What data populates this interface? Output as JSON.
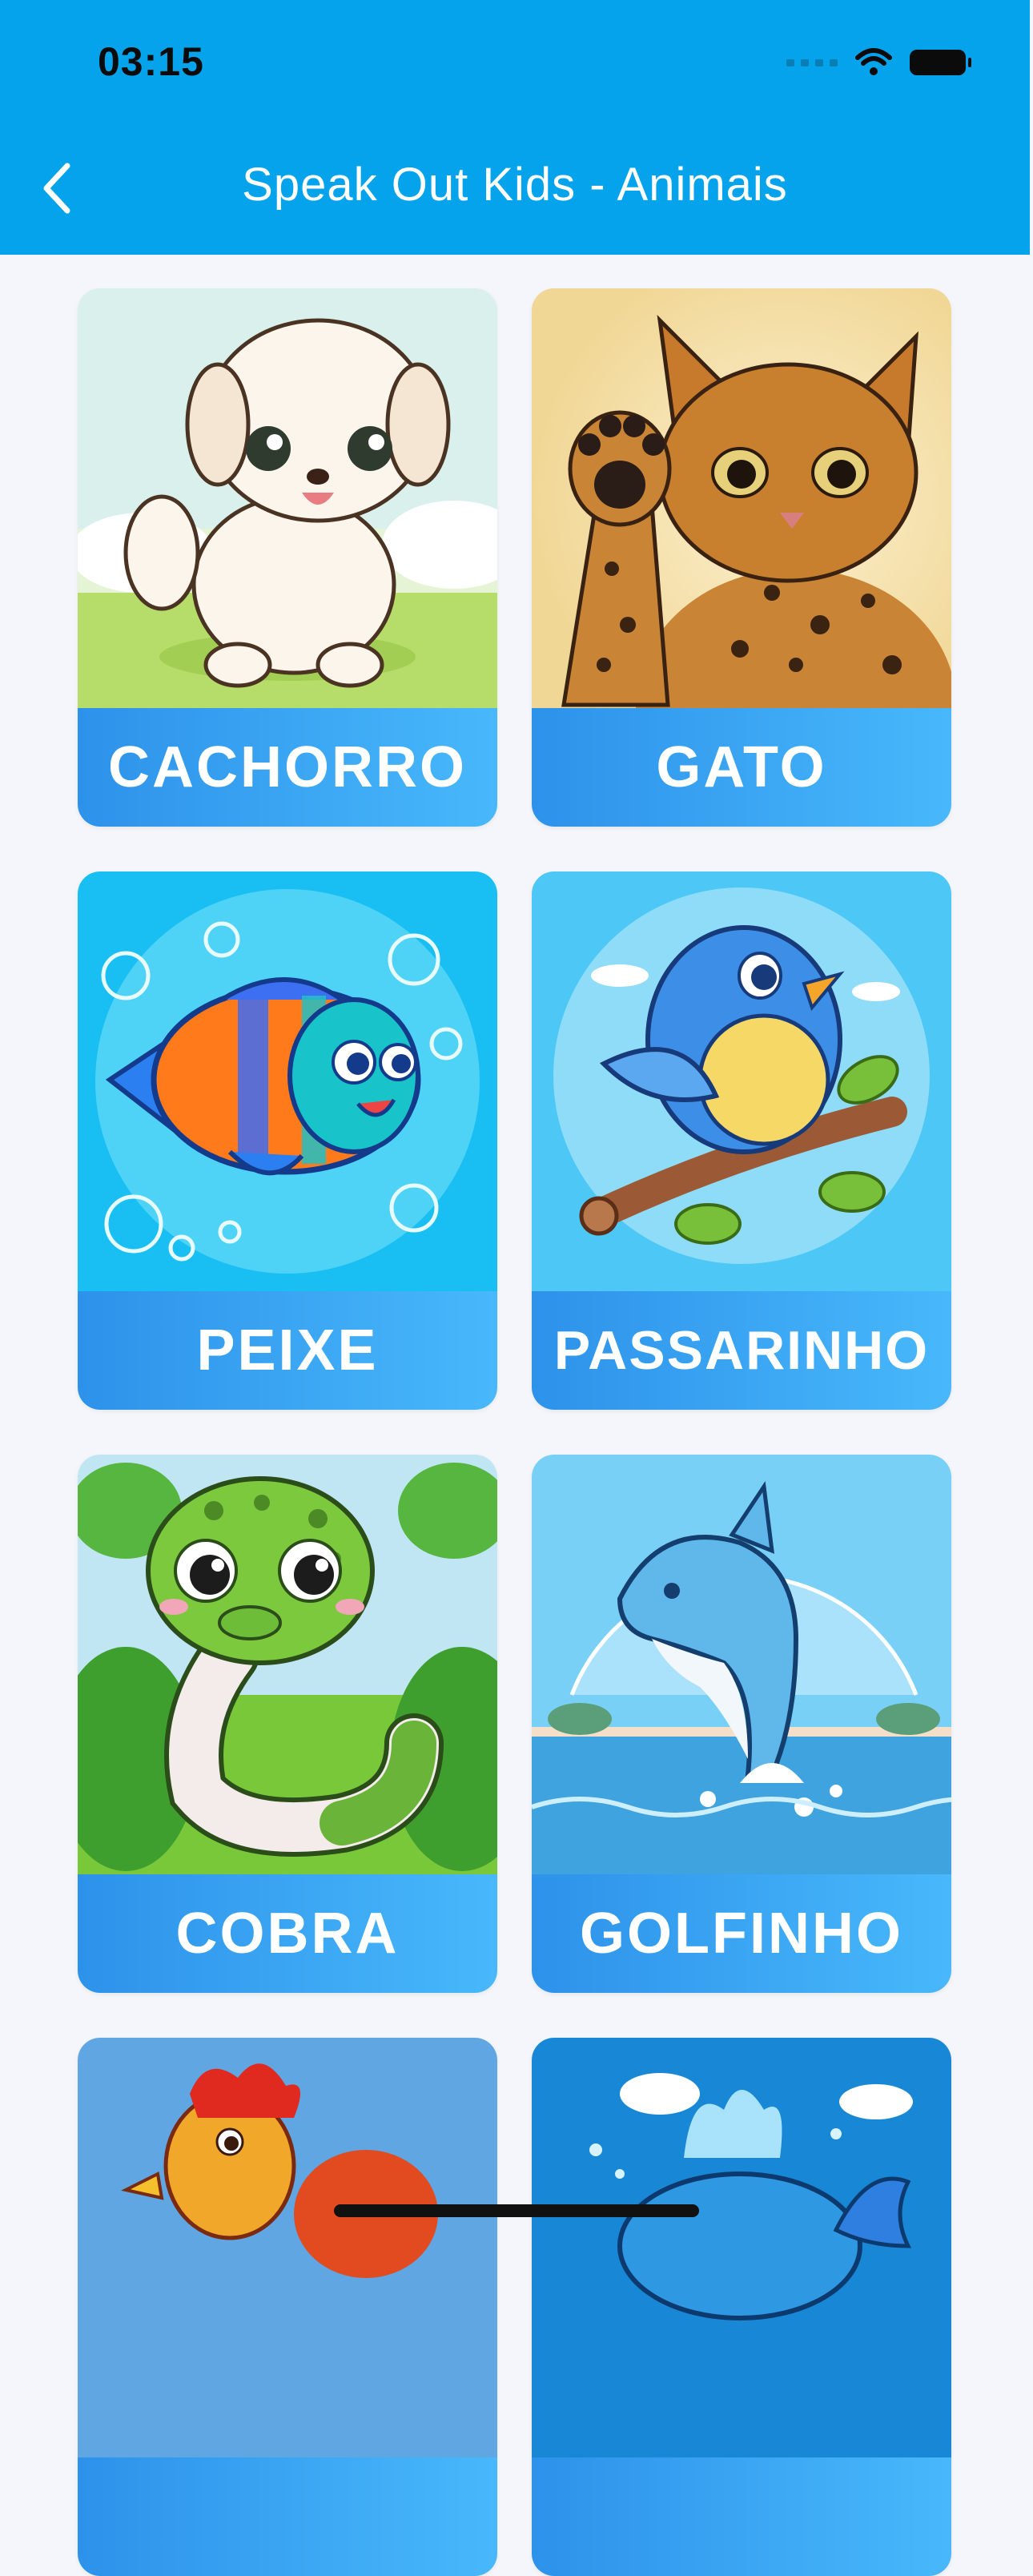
{
  "status_bar": {
    "time": "03:15"
  },
  "header": {
    "title": "Speak Out Kids - Animais"
  },
  "animals": [
    {
      "label": "CACHORRO",
      "icon": "dog-illustration"
    },
    {
      "label": "GATO",
      "icon": "cat-illustration"
    },
    {
      "label": "PEIXE",
      "icon": "fish-illustration"
    },
    {
      "label": "PASSARINHO",
      "icon": "bird-illustration"
    },
    {
      "label": "COBRA",
      "icon": "snake-illustration"
    },
    {
      "label": "GOLFINHO",
      "icon": "dolphin-illustration"
    },
    {
      "label": "",
      "icon": "rooster-illustration"
    },
    {
      "label": "",
      "icon": "whale-illustration"
    }
  ],
  "colors": {
    "header": "#04a3ec",
    "label_gradient_start": "#2d92ea",
    "label_gradient_end": "#48b8fb",
    "background": "#f4f6fb"
  }
}
